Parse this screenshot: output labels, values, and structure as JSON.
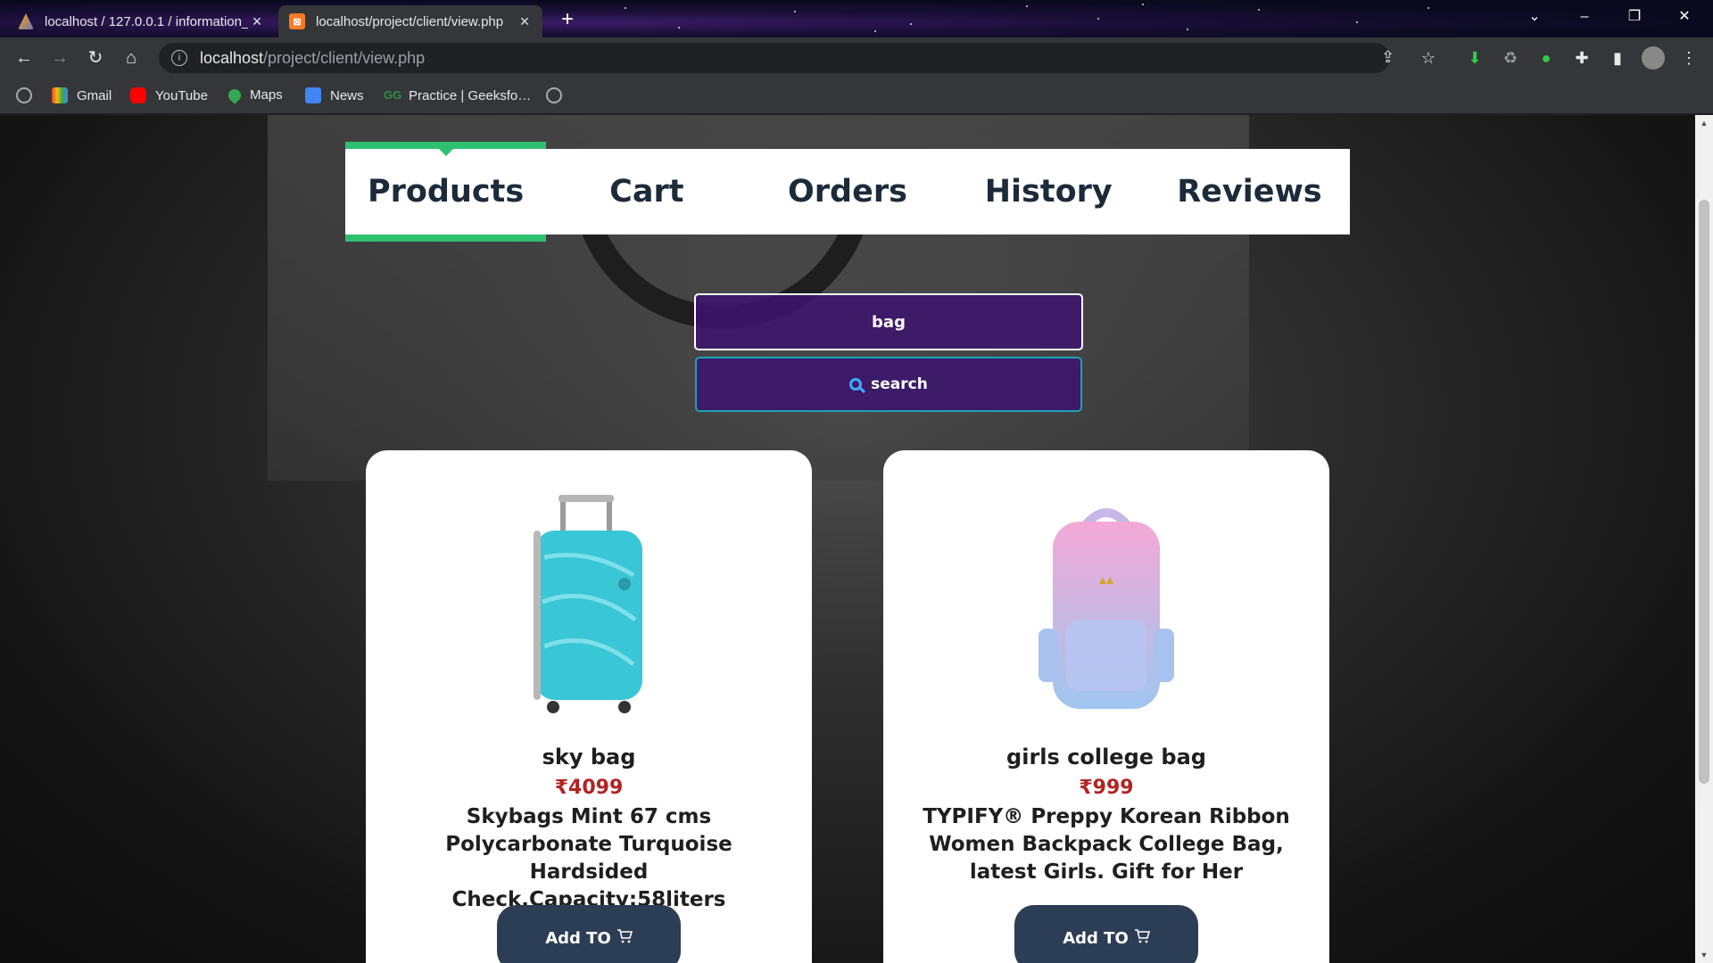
{
  "browser": {
    "tabs": [
      {
        "title": "localhost / 127.0.0.1 / information_",
        "active": false
      },
      {
        "title": "localhost/project/client/view.php",
        "active": true
      }
    ],
    "url_host": "localhost",
    "url_path": "/project/client/view.php",
    "bookmarks": [
      "Gmail",
      "YouTube",
      "Maps",
      "News",
      "Practice | GeeksforGeeks"
    ]
  },
  "nav": {
    "items": [
      "Products",
      "Cart",
      "Orders",
      "History",
      "Reviews"
    ],
    "active": "Products",
    "accent": "#2fbf71"
  },
  "search": {
    "value": "bag",
    "button_label": "search"
  },
  "products": [
    {
      "name": "sky bag",
      "price": "₹4099",
      "description": "Skybags Mint 67 cms Polycarbonate Turquoise Hardsided Check,Capacity:58liters",
      "button_label": "Add TO"
    },
    {
      "name": "girls college bag",
      "price": "₹999",
      "description": "TYPIFY® Preppy Korean Ribbon Women Backpack College Bag, latest Girls. Gift for Her",
      "button_label": "Add TO"
    }
  ],
  "colors": {
    "price": "#b22222",
    "button_bg": "#2c3e55",
    "search_bg": "#3c146e"
  }
}
